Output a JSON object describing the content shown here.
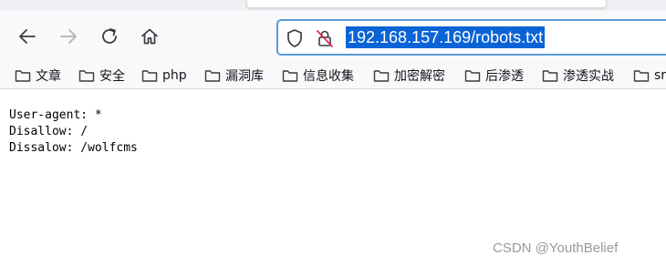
{
  "browser": {
    "address_bar": {
      "url": "192.168.157.169/robots.txt"
    },
    "nav_icons": [
      "back-icon",
      "forward-icon",
      "reload-icon",
      "home-icon"
    ],
    "bookmarks": [
      {
        "label": "文章"
      },
      {
        "label": "安全"
      },
      {
        "label": "php"
      },
      {
        "label": "漏洞库"
      },
      {
        "label": "信息收集"
      },
      {
        "label": "加密解密"
      },
      {
        "label": "后渗透"
      },
      {
        "label": "渗透实战"
      },
      {
        "label": "sr"
      }
    ]
  },
  "content": {
    "lines": [
      "User-agent: *",
      "Disallow: /",
      "Dissalow: /wolfcms"
    ]
  },
  "watermark": "CSDN @YouthBelief",
  "colors": {
    "selection": "#0a64d6",
    "url_border": "#5b9bd5",
    "toolbar_bg": "#f9f9fb"
  }
}
